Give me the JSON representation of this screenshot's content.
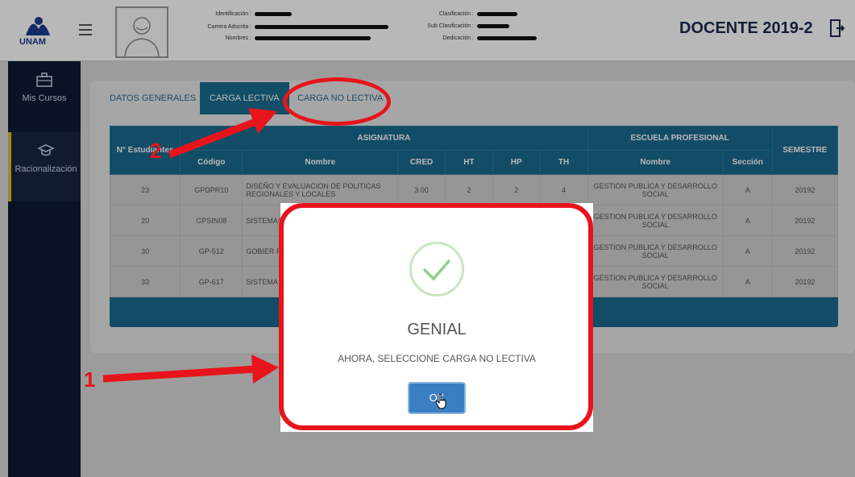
{
  "header": {
    "logo_text": "UNAM",
    "title": "DOCENTE 2019-2",
    "labels": {
      "identificacion": "Identificación :",
      "carrera": "Carrera Adscrita :",
      "nombres": "Nombres :",
      "clasificacion": "Clasificación :",
      "sub_clasificacion": "Sub Clasificación :",
      "dedicacion": "Dedicación :"
    }
  },
  "sidebar": {
    "items": [
      {
        "label": "Mis Cursos",
        "icon": "briefcase-icon"
      },
      {
        "label": "Racionalización",
        "icon": "graduation-cap-icon"
      }
    ]
  },
  "tabs": [
    {
      "label": "DATOS GENERALES"
    },
    {
      "label": "CARGA LECTIVA"
    },
    {
      "label": "CARGA NO LECTIVA"
    }
  ],
  "table": {
    "group_headers": {
      "n_estudiantes": "N° Estudiantes",
      "asignatura": "ASIGNATURA",
      "escuela": "ESCUELA PROFESIONAL",
      "semestre": "SEMESTRE"
    },
    "sub_headers": [
      "Código",
      "Nombre",
      "CRED",
      "HT",
      "HP",
      "TH",
      "Nombre",
      "Sección"
    ],
    "rows": [
      {
        "n": "23",
        "codigo": "GPDPR10",
        "nombre": "DISEÑO Y EVALUACION DE POLITICAS REGIONALES Y LOCALES",
        "cred": "3.00",
        "ht": "2",
        "hp": "2",
        "th": "4",
        "escuela": "GESTION PUBLICA Y DESARROLLO SOCIAL",
        "seccion": "A",
        "semestre": "20192"
      },
      {
        "n": "20",
        "codigo": "GPSIN08",
        "nombre": "SISTEMAS",
        "cred": "",
        "ht": "",
        "hp": "",
        "th": "",
        "escuela": "GESTION PUBLICA Y DESARROLLO SOCIAL",
        "seccion": "A",
        "semestre": "20192"
      },
      {
        "n": "30",
        "codigo": "GP-512",
        "nombre": "GOBIER REGIONA",
        "cred": "",
        "ht": "",
        "hp": "",
        "th": "",
        "escuela": "GESTION PUBLICA Y DESARROLLO SOCIAL",
        "seccion": "A",
        "semestre": "20192"
      },
      {
        "n": "33",
        "codigo": "GP-617",
        "nombre": "SISTEMA",
        "cred": "",
        "ht": "",
        "hp": "",
        "th": "",
        "escuela": "GESTION PUBLICA Y DESARROLLO SOCIAL",
        "seccion": "A",
        "semestre": "20192"
      }
    ]
  },
  "modal": {
    "title": "GENIAL",
    "message": "AHORA, SELECCIONE CARGA NO LECTIVA",
    "ok_label": "OK"
  },
  "annotations": {
    "step1": "1",
    "step2": "2",
    "color": "#e8141c"
  }
}
